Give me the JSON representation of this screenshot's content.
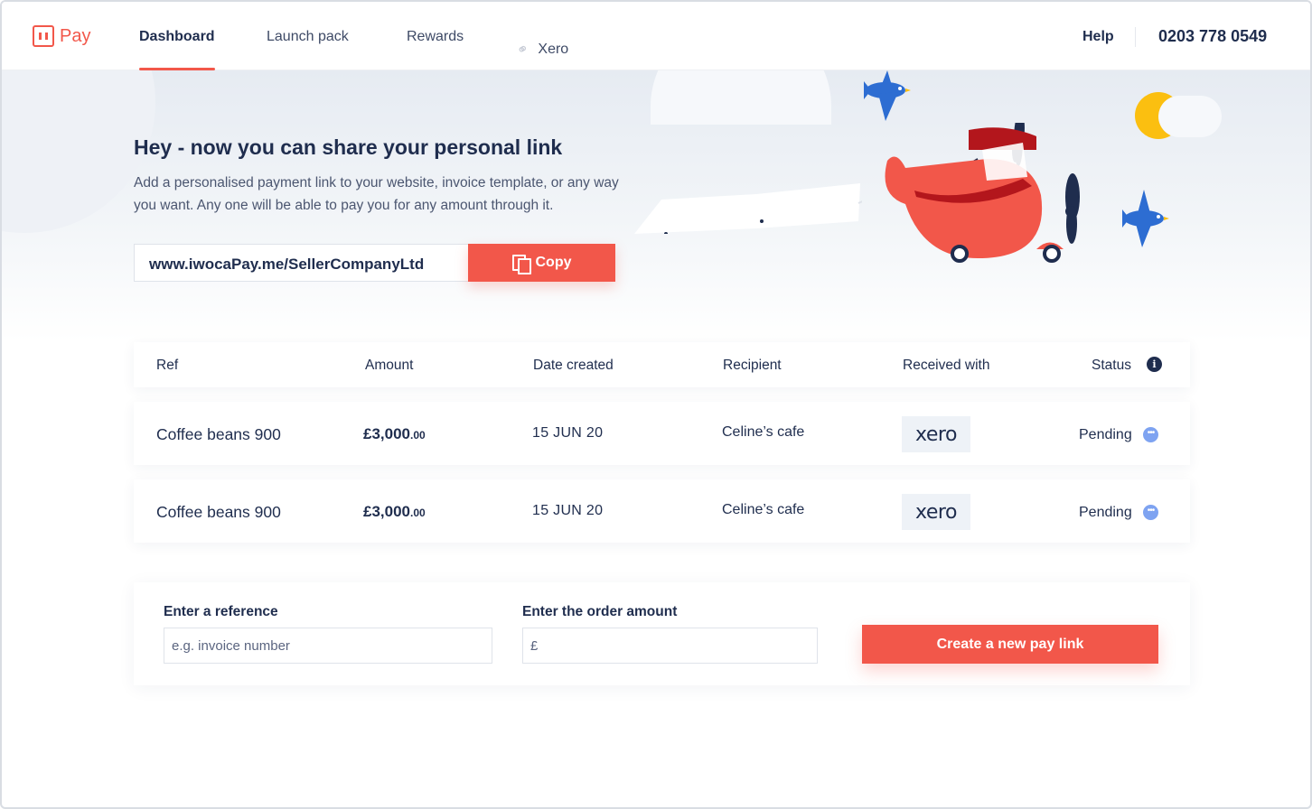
{
  "brand": {
    "logo_text": "Pay",
    "accent_color": "#f2574a"
  },
  "nav": {
    "items": [
      {
        "label": "Dashboard",
        "active": true
      },
      {
        "label": "Launch pack",
        "active": false
      },
      {
        "label": "Rewards",
        "active": false
      },
      {
        "label": "Xero",
        "active": false,
        "icon": "link-icon"
      }
    ],
    "help_label": "Help",
    "phone": "0203 778 0549"
  },
  "hero": {
    "title": "Hey - now you can share your personal link",
    "description": "Add a personalised payment link to your website, invoice template, or any way you want. Any one will be able to pay you for any amount through it.",
    "link_value": "www.iwocaPay.me/SellerCompanyLtd",
    "copy_label": "Copy"
  },
  "table": {
    "headers": [
      "Ref",
      "Amount",
      "Date created",
      "Recipient",
      "Received with",
      "Status"
    ],
    "rows": [
      {
        "ref": "Coffee beans 900",
        "amount": "£3,000",
        "amount_decimal": ".00",
        "date": "15 JUN 20",
        "recipient": "Celine’s cafe",
        "received_with": "xero",
        "status": "Pending"
      },
      {
        "ref": "Coffee beans 900",
        "amount": "£3,000",
        "amount_decimal": ".00",
        "date": "15 JUN 20",
        "recipient": "Celine’s cafe",
        "received_with": "xero",
        "status": "Pending"
      }
    ]
  },
  "form": {
    "reference_label": "Enter a reference",
    "reference_placeholder": "e.g. invoice number",
    "amount_label": "Enter the order amount",
    "amount_placeholder": "£",
    "create_label": "Create a new pay link"
  }
}
